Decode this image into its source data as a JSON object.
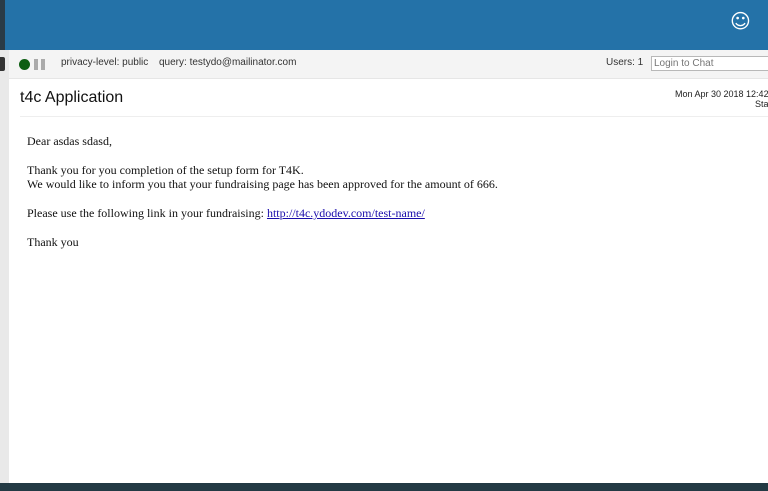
{
  "header": {
    "icon": "smiley-icon",
    "glyph": "☺",
    "background": "#2472a8"
  },
  "status_bar": {
    "privacy": "privacy-level: public",
    "query": "query: testydo@mailinator.com",
    "users": "Users: 1",
    "login_placeholder": "Login to Chat",
    "status_color": "#0d5e12"
  },
  "message": {
    "title": "t4c Application",
    "datetime": "Mon Apr 30 2018 12:42:",
    "status_truncated": "Sta",
    "greeting": "Dear asdas sdasd,",
    "line1": "Thank you for you completion of the setup form for T4K.",
    "line2": "We would like to inform you that your fundraising page has been approved for the amount of 666.",
    "link_prefix": "Please use the following link in your fundraising: ",
    "link_text": "http://t4c.ydodev.com/test-name/",
    "closing": "Thank you"
  }
}
